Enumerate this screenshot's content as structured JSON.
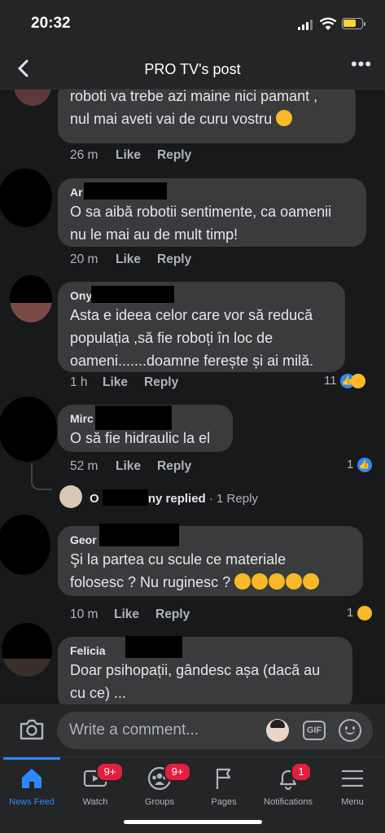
{
  "status_bar": {
    "time": "20:32"
  },
  "header": {
    "title": "PRO TV's post"
  },
  "comments": [
    {
      "author": "",
      "lines": [
        "roboti va trebe azi maine nici  pamant ,",
        "nul mai aveti vai de curu vostru"
      ],
      "time": "26 m",
      "like_label": "Like",
      "reply_label": "Reply"
    },
    {
      "author": "Ar",
      "lines": [
        "O sa aibă robotii sentimente, ca oamenii",
        "nu le mai au de mult timp!"
      ],
      "time": "20 m",
      "like_label": "Like",
      "reply_label": "Reply"
    },
    {
      "author": "Ony",
      "lines": [
        "Asta e ideea celor care vor să reducă",
        "populația ,să fie roboți în loc de",
        "oameni.......doamne ferește și ai milă."
      ],
      "time": "1 h",
      "like_label": "Like",
      "reply_label": "Reply",
      "reaction_count": "11"
    },
    {
      "author": "Mirc",
      "lines": [
        "O să fie hidraulic la el"
      ],
      "time": "52 m",
      "like_label": "Like",
      "reply_label": "Reply",
      "reaction_count": "1",
      "reply_preview": {
        "name_suffix": "ny replied",
        "name_prefix": "O",
        "count": "· 1 Reply"
      }
    },
    {
      "author": "Geor",
      "lines": [
        "Şi la partea cu scule ce materiale",
        "folosesc ? Nu ruginesc ?"
      ],
      "time": "10 m",
      "like_label": "Like",
      "reply_label": "Reply",
      "reaction_count": "1"
    },
    {
      "author": "Felicia",
      "lines": [
        "Doar psihopații, gândesc așa (dacă au",
        "cu ce) ..."
      ]
    }
  ],
  "composer": {
    "placeholder": "Write a comment..."
  },
  "tabs": [
    {
      "label": "News Feed",
      "icon": "home-icon",
      "active": true
    },
    {
      "label": "Watch",
      "icon": "watch-icon",
      "badge": "9+"
    },
    {
      "label": "Groups",
      "icon": "groups-icon",
      "badge": "9+"
    },
    {
      "label": "Pages",
      "icon": "flag-icon"
    },
    {
      "label": "Notifications",
      "icon": "bell-icon",
      "badge": "1"
    },
    {
      "label": "Menu",
      "icon": "menu-icon"
    }
  ],
  "colors": {
    "accent": "#2d88ff",
    "bubble": "#3a3b3c",
    "background": "#18191a",
    "badge": "#e41e3f"
  }
}
